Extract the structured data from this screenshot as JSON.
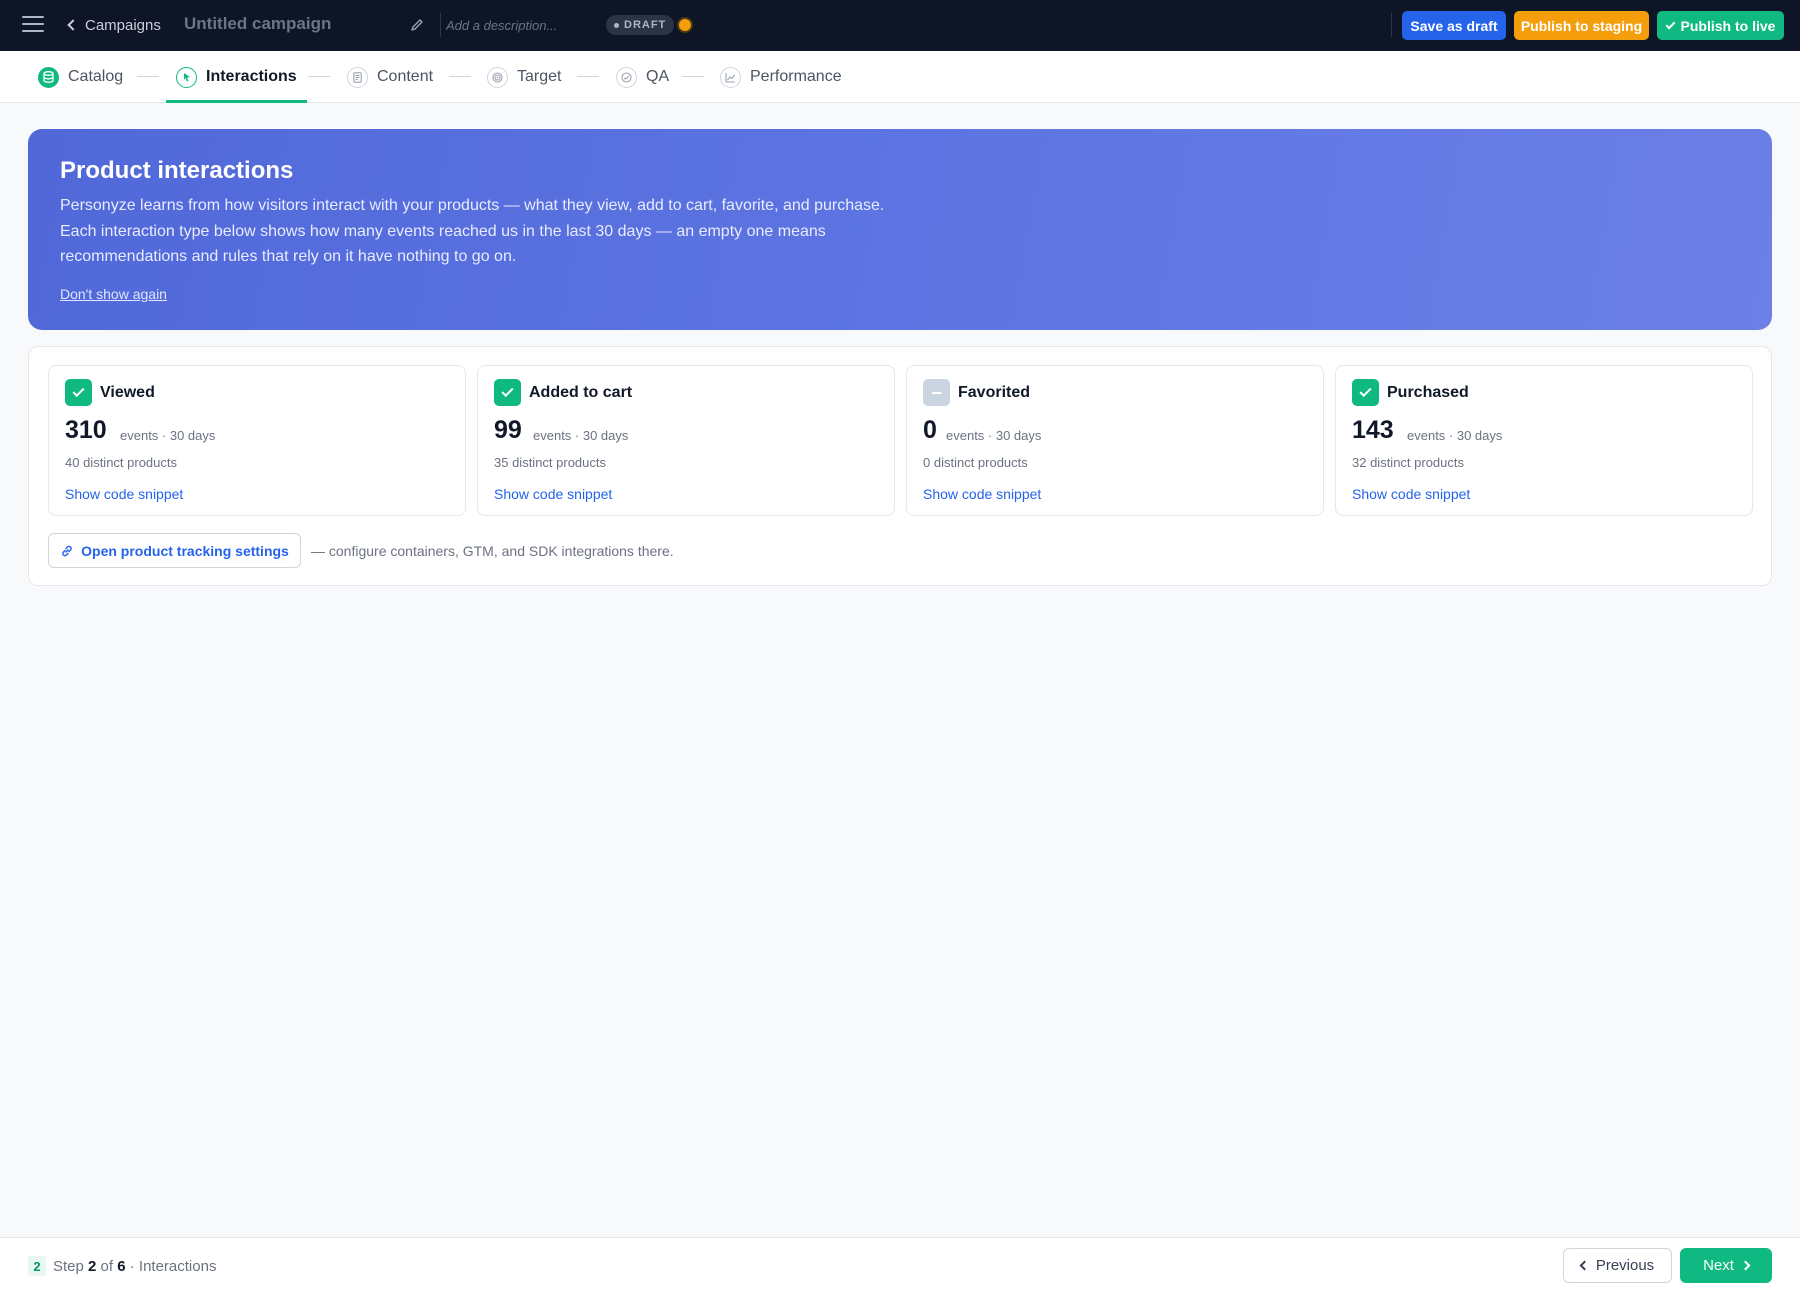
{
  "header": {
    "back_label": "Campaigns",
    "campaign_title": "Untitled campaign",
    "description_placeholder": "Add a description...",
    "status_badge": "DRAFT",
    "buttons": {
      "save_draft": "Save as draft",
      "publish_staging": "Publish to staging",
      "publish_live": "Publish to live"
    },
    "colors": {
      "save_draft": "#2563eb",
      "publish_staging": "#f59e0b",
      "publish_live": "#10b981"
    }
  },
  "steps": [
    {
      "label": "Catalog",
      "icon": "database-icon",
      "state": "done"
    },
    {
      "label": "Interactions",
      "icon": "cursor-icon",
      "state": "active"
    },
    {
      "label": "Content",
      "icon": "document-icon",
      "state": "pending"
    },
    {
      "label": "Target",
      "icon": "target-icon",
      "state": "pending"
    },
    {
      "label": "QA",
      "icon": "check-circle-icon",
      "state": "pending"
    },
    {
      "label": "Performance",
      "icon": "chart-icon",
      "state": "pending"
    }
  ],
  "banner": {
    "title": "Product interactions",
    "body": "Personyze learns from how visitors interact with your products — what they view, add to cart, favorite, and purchase. Each interaction type below shows how many events reached us in the last 30 days — an empty one means recommendations and rules that rely on it have nothing to go on.",
    "dismiss": "Don't show again"
  },
  "interactions": [
    {
      "title": "Viewed",
      "count": "310",
      "unit": "events · 30 days",
      "distinct": "40 distinct products",
      "snippet": "Show code snippet",
      "status": "ok"
    },
    {
      "title": "Added to cart",
      "count": "99",
      "unit": "events · 30 days",
      "distinct": "35 distinct products",
      "snippet": "Show code snippet",
      "status": "ok"
    },
    {
      "title": "Favorited",
      "count": "0",
      "unit": "events · 30 days",
      "distinct": "0 distinct products",
      "snippet": "Show code snippet",
      "status": "empty"
    },
    {
      "title": "Purchased",
      "count": "143",
      "unit": "events · 30 days",
      "distinct": "32 distinct products",
      "snippet": "Show code snippet",
      "status": "ok"
    }
  ],
  "tracking": {
    "button": "Open product tracking settings",
    "note": "— configure containers, GTM, and SDK integrations there."
  },
  "footer": {
    "step_badge": "2",
    "step_word": "Step",
    "current": "2",
    "of_word": "of",
    "total": "6",
    "step_name": "· Interactions",
    "previous": "Previous",
    "next": "Next"
  }
}
